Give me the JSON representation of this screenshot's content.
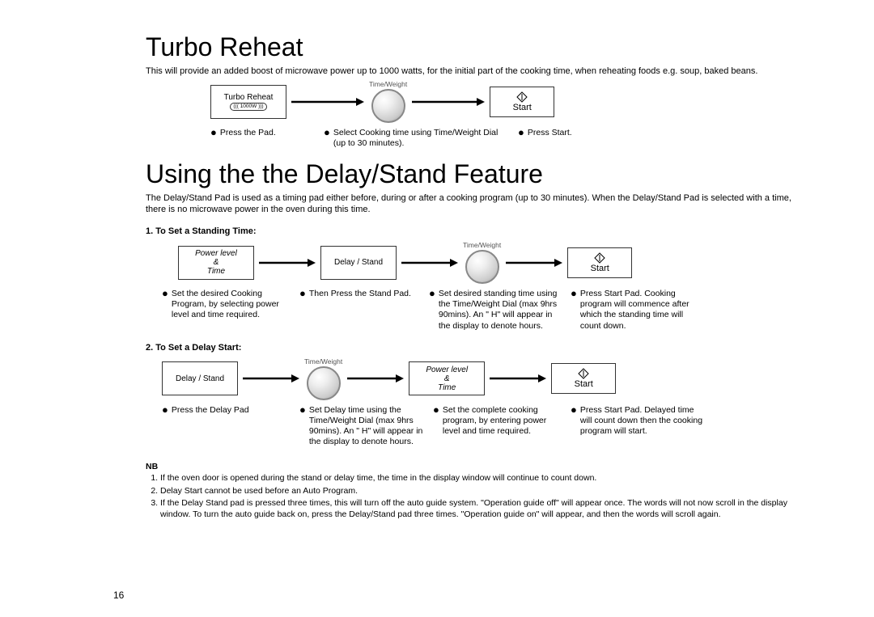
{
  "turbo": {
    "heading": "Turbo Reheat",
    "intro": "This will provide an added boost of microwave power up to 1000 watts, for the initial part of the cooking time, when reheating foods e.g. soup, baked beans.",
    "pad_label": "Turbo Reheat",
    "pad_watt": "1000W",
    "dial_top": "Time/Weight",
    "start": "Start",
    "step1": "Press the Pad.",
    "step2": "Select Cooking time using Time/Weight Dial (up to 30 minutes).",
    "step3": "Press Start."
  },
  "delay": {
    "heading": "Using the the Delay/Stand Feature",
    "intro": "The Delay/Stand Pad is used as a timing pad either before, during or after a cooking program (up to 30 minutes). When the Delay/Stand Pad is selected with a time, there is no microwave power in the oven during this time.",
    "standing": {
      "title": "1. To Set a Standing Time:",
      "pad1_line1": "Power level",
      "pad1_line2": "&",
      "pad1_line3": "Time",
      "pad2": "Delay / Stand",
      "dial_top": "Time/Weight",
      "start": "Start",
      "d1": "Set the desired Cooking Program, by selecting power level and time required.",
      "d2": "Then Press the Stand Pad.",
      "d3": "Set desired standing time using the Time/Weight Dial (max 9hrs 90mins). An \" H\" will appear in the display to denote hours.",
      "d4": "Press Start Pad. Cooking program will commence after which the standing time will count down."
    },
    "delaystart": {
      "title": "2. To Set a Delay Start:",
      "pad1": "Delay / Stand",
      "dial_top": "Time/Weight",
      "pad3_line1": "Power level",
      "pad3_line2": "&",
      "pad3_line3": "Time",
      "start": "Start",
      "d1": "Press the Delay Pad",
      "d2": "Set Delay time using the Time/Weight Dial (max 9hrs 90mins). An \" H\" will appear in the display to denote hours.",
      "d3": "Set the complete cooking program, by entering power level and time required.",
      "d4": "Press Start Pad. Delayed time will count down then the cooking program will start."
    }
  },
  "nb": {
    "title": "NB",
    "n1": "If the oven door is opened during the stand or delay time, the time in the display window will continue to count down.",
    "n2": "Delay Start cannot be used before an Auto Program.",
    "n3": "If the Delay Stand pad is pressed three times, this will turn off the auto guide system. \"Operation guide off\" will appear once. The words will not now scroll in the display window. To turn the auto guide back on, press the Delay/Stand pad three times. \"Operation guide on\" will appear, and then the words will scroll again."
  },
  "page_number": "16"
}
